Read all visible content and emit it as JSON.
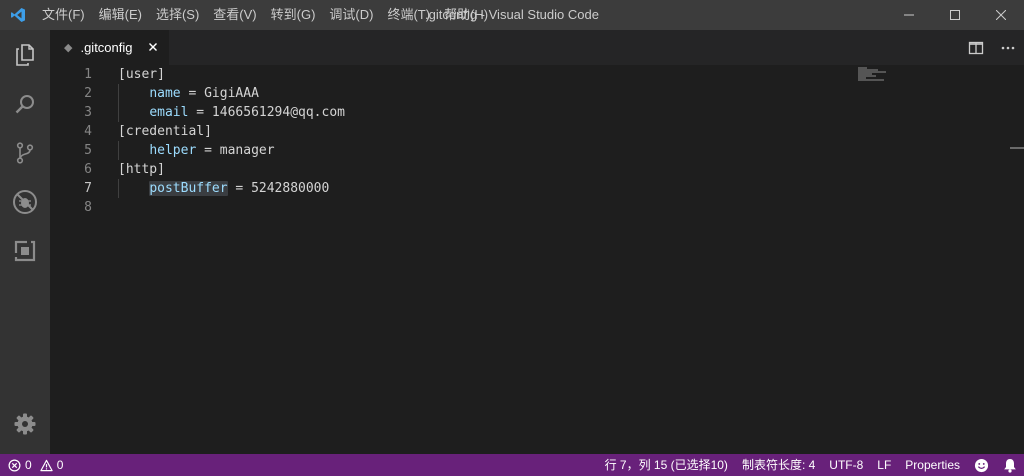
{
  "titlebar": {
    "menu": [
      "文件(F)",
      "编辑(E)",
      "选择(S)",
      "查看(V)",
      "转到(G)",
      "调试(D)",
      "终端(T)",
      "帮助(H)"
    ],
    "window_title": ".gitconfig - Visual Studio Code"
  },
  "activitybar": {
    "items": [
      "files-icon",
      "search-icon",
      "source-control-icon",
      "debug-icon",
      "extensions-icon"
    ],
    "bottom": "gear-icon"
  },
  "tab": {
    "label": ".gitconfig",
    "file_icon": "◆"
  },
  "editor": {
    "active_line": 7,
    "lines": [
      {
        "n": "1",
        "parts": [
          [
            "t",
            "[user]"
          ]
        ]
      },
      {
        "n": "2",
        "parts": [
          [
            "t",
            "    "
          ],
          [
            "k",
            "name"
          ],
          [
            "t",
            " = GigiAAA"
          ]
        ]
      },
      {
        "n": "3",
        "parts": [
          [
            "t",
            "    "
          ],
          [
            "k",
            "email"
          ],
          [
            "t",
            " = 1466561294@qq.com"
          ]
        ]
      },
      {
        "n": "4",
        "parts": [
          [
            "t",
            "[credential]"
          ]
        ]
      },
      {
        "n": "5",
        "parts": [
          [
            "t",
            "    "
          ],
          [
            "k",
            "helper"
          ],
          [
            "t",
            " = manager"
          ]
        ]
      },
      {
        "n": "6",
        "parts": [
          [
            "t",
            "[http]"
          ]
        ]
      },
      {
        "n": "7",
        "parts": [
          [
            "t",
            "    "
          ],
          [
            "h",
            "postBuffer"
          ],
          [
            "t",
            " = 5242880000"
          ]
        ]
      },
      {
        "n": "8",
        "parts": []
      }
    ]
  },
  "statusbar": {
    "errors": "0",
    "warnings": "0",
    "position": "行 7，列 15 (已选择10)",
    "indent": "制表符长度: 4",
    "encoding": "UTF-8",
    "eol": "LF",
    "language": "Properties"
  },
  "colors": {
    "statusbar_bg": "#68217a",
    "key": "#9cdcfe",
    "selection_highlight": "#3a3d41",
    "vscode_blue": "#3d9ee8"
  }
}
